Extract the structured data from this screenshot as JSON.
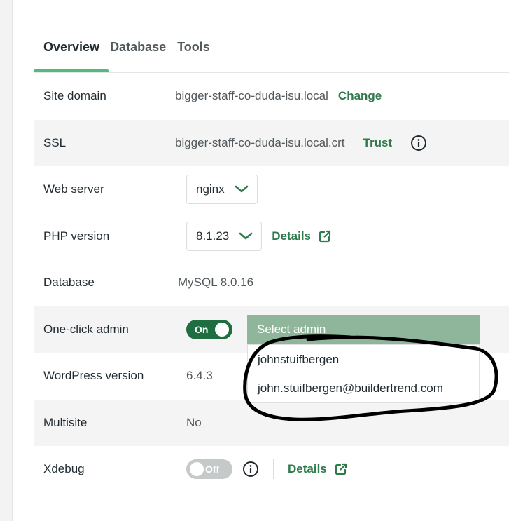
{
  "tabs": [
    {
      "label": "Overview",
      "active": true
    },
    {
      "label": "Database",
      "active": false
    },
    {
      "label": "Tools",
      "active": false
    }
  ],
  "rows": {
    "site_domain": {
      "label": "Site domain",
      "value": "bigger-staff-co-duda-isu.local",
      "action": "Change"
    },
    "ssl": {
      "label": "SSL",
      "value": "bigger-staff-co-duda-isu.local.crt",
      "action": "Trust",
      "info_icon": "info-icon"
    },
    "web_server": {
      "label": "Web server",
      "selected": "nginx"
    },
    "php_version": {
      "label": "PHP version",
      "selected": "8.1.23",
      "action": "Details"
    },
    "database": {
      "label": "Database",
      "value": "MySQL 8.0.16"
    },
    "one_click_admin": {
      "label": "One-click admin",
      "toggle": "On",
      "select_placeholder": "Select admin",
      "options": [
        "johnstuifbergen",
        "john.stuifbergen@buildertrend.com"
      ]
    },
    "wordpress_version": {
      "label": "WordPress version",
      "value": "6.4.3"
    },
    "multisite": {
      "label": "Multisite",
      "value": "No"
    },
    "xdebug": {
      "label": "Xdebug",
      "toggle": "Off",
      "action": "Details"
    }
  },
  "colors": {
    "accent": "#51bb7b",
    "link": "#2f7a4c",
    "toggle_on": "#1f6e42",
    "toggle_off": "#c6c9ca",
    "select_admin_bg": "#8fb69a"
  }
}
